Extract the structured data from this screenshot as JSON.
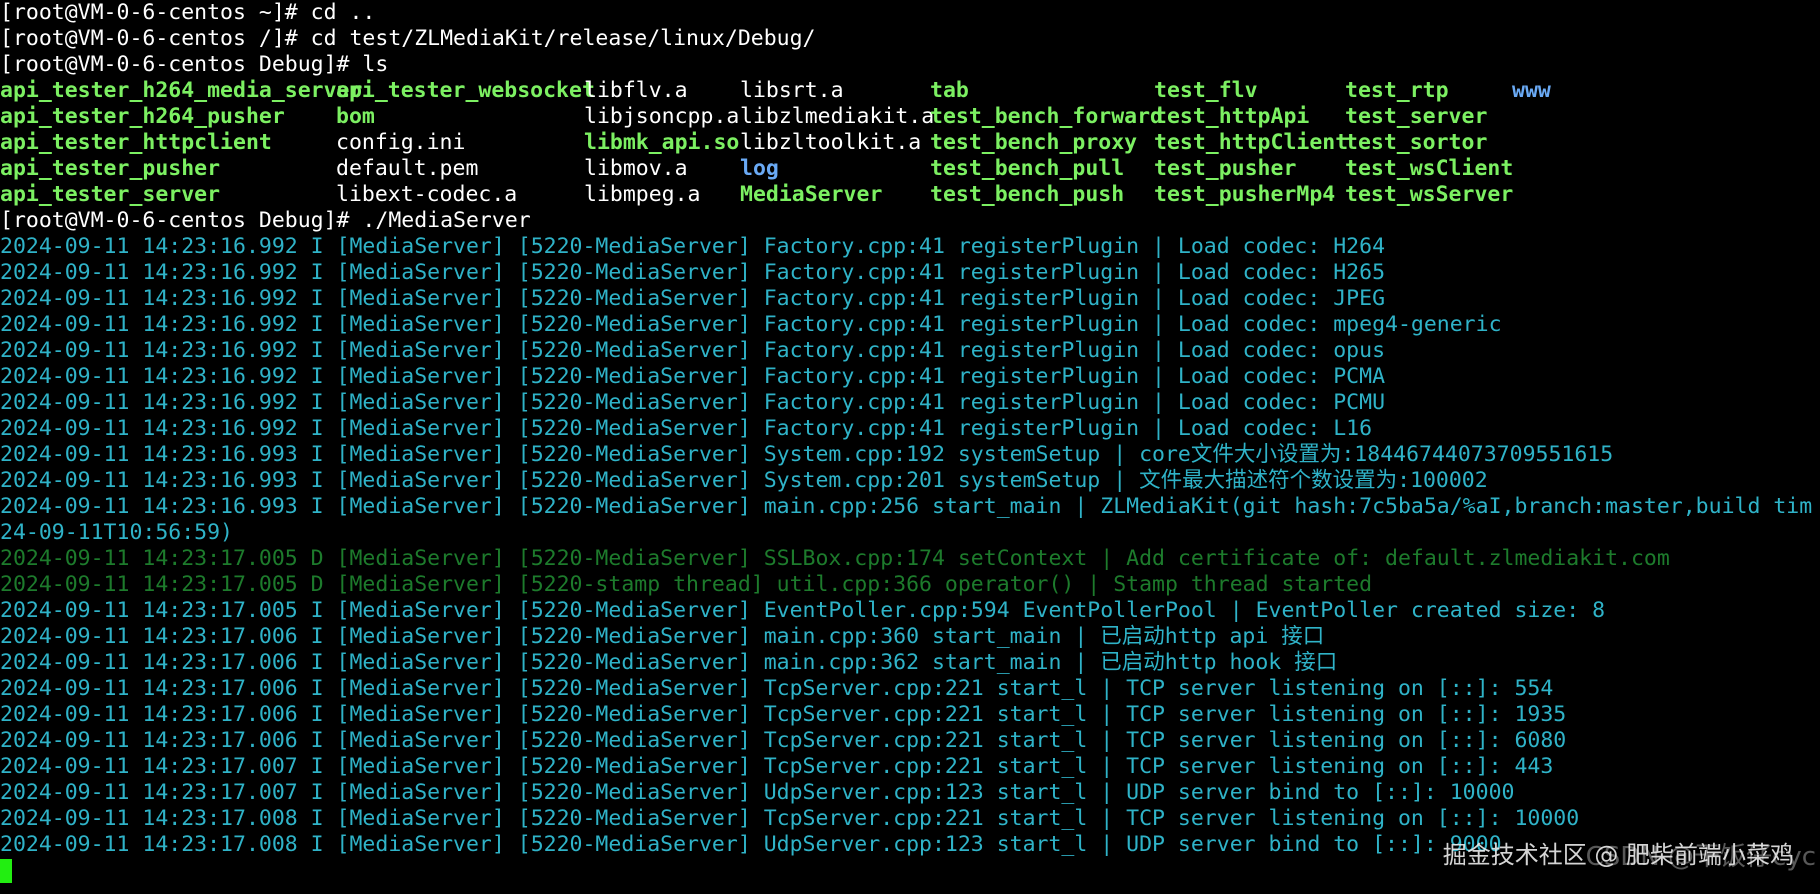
{
  "terminal": {
    "colors": {
      "background": "#000000",
      "prompt": "#ffffff",
      "executable": "#7cf062",
      "directory": "#6aaaf5",
      "info_log": "#2fb3c8",
      "debug_log": "#1d7b2c",
      "cursor": "#22ee11"
    },
    "commands": [
      "[root@VM-0-6-centos ~]# cd ..",
      "[root@VM-0-6-centos /]# cd test/ZLMediaKit/release/linux/Debug/",
      "[root@VM-0-6-centos Debug]# ls"
    ],
    "ls_listing": [
      [
        {
          "name": "api_tester_h264_media_server",
          "kind": "exe"
        },
        {
          "name": "api_tester_websocket",
          "kind": "exe"
        },
        {
          "name": "libflv.a",
          "kind": "plain"
        },
        {
          "name": "libsrt.a",
          "kind": "plain"
        },
        {
          "name": "tab",
          "kind": "exe"
        },
        {
          "name": "test_flv",
          "kind": "exe"
        },
        {
          "name": "test_rtp",
          "kind": "exe"
        },
        {
          "name": "www",
          "kind": "dir"
        }
      ],
      [
        {
          "name": "api_tester_h264_pusher",
          "kind": "exe"
        },
        {
          "name": "bom",
          "kind": "exe"
        },
        {
          "name": "libjsoncpp.a",
          "kind": "plain"
        },
        {
          "name": "libzlmediakit.a",
          "kind": "plain"
        },
        {
          "name": "test_bench_forward",
          "kind": "exe"
        },
        {
          "name": "test_httpApi",
          "kind": "exe"
        },
        {
          "name": "test_server",
          "kind": "exe"
        }
      ],
      [
        {
          "name": "api_tester_httpclient",
          "kind": "exe"
        },
        {
          "name": "config.ini",
          "kind": "plain"
        },
        {
          "name": "libmk_api.so",
          "kind": "exe"
        },
        {
          "name": "libzltoolkit.a",
          "kind": "plain"
        },
        {
          "name": "test_bench_proxy",
          "kind": "exe"
        },
        {
          "name": "test_httpClient",
          "kind": "exe"
        },
        {
          "name": "test_sortor",
          "kind": "exe"
        }
      ],
      [
        {
          "name": "api_tester_pusher",
          "kind": "exe"
        },
        {
          "name": "default.pem",
          "kind": "plain"
        },
        {
          "name": "libmov.a",
          "kind": "plain"
        },
        {
          "name": "log",
          "kind": "dir"
        },
        {
          "name": "test_bench_pull",
          "kind": "exe"
        },
        {
          "name": "test_pusher",
          "kind": "exe"
        },
        {
          "name": "test_wsClient",
          "kind": "exe"
        }
      ],
      [
        {
          "name": "api_tester_server",
          "kind": "exe"
        },
        {
          "name": "libext-codec.a",
          "kind": "plain"
        },
        {
          "name": "libmpeg.a",
          "kind": "plain"
        },
        {
          "name": "MediaServer",
          "kind": "exe"
        },
        {
          "name": "test_bench_push",
          "kind": "exe"
        },
        {
          "name": "test_pusherMp4",
          "kind": "exe"
        },
        {
          "name": "test_wsServer",
          "kind": "exe"
        }
      ]
    ],
    "run_command": "[root@VM-0-6-centos Debug]# ./MediaServer",
    "log_lines": [
      {
        "text": "2024-09-11 14:23:16.992 I [MediaServer] [5220-MediaServer] Factory.cpp:41 registerPlugin | Load codec: H264",
        "level": "info"
      },
      {
        "text": "2024-09-11 14:23:16.992 I [MediaServer] [5220-MediaServer] Factory.cpp:41 registerPlugin | Load codec: H265",
        "level": "info"
      },
      {
        "text": "2024-09-11 14:23:16.992 I [MediaServer] [5220-MediaServer] Factory.cpp:41 registerPlugin | Load codec: JPEG",
        "level": "info"
      },
      {
        "text": "2024-09-11 14:23:16.992 I [MediaServer] [5220-MediaServer] Factory.cpp:41 registerPlugin | Load codec: mpeg4-generic",
        "level": "info"
      },
      {
        "text": "2024-09-11 14:23:16.992 I [MediaServer] [5220-MediaServer] Factory.cpp:41 registerPlugin | Load codec: opus",
        "level": "info"
      },
      {
        "text": "2024-09-11 14:23:16.992 I [MediaServer] [5220-MediaServer] Factory.cpp:41 registerPlugin | Load codec: PCMA",
        "level": "info"
      },
      {
        "text": "2024-09-11 14:23:16.992 I [MediaServer] [5220-MediaServer] Factory.cpp:41 registerPlugin | Load codec: PCMU",
        "level": "info"
      },
      {
        "text": "2024-09-11 14:23:16.992 I [MediaServer] [5220-MediaServer] Factory.cpp:41 registerPlugin | Load codec: L16",
        "level": "info"
      },
      {
        "text": "2024-09-11 14:23:16.993 I [MediaServer] [5220-MediaServer] System.cpp:192 systemSetup | core文件大小设置为:18446744073709551615",
        "level": "info"
      },
      {
        "text": "2024-09-11 14:23:16.993 I [MediaServer] [5220-MediaServer] System.cpp:201 systemSetup | 文件最大描述符个数设置为:100002",
        "level": "info"
      },
      {
        "text": "2024-09-11 14:23:16.993 I [MediaServer] [5220-MediaServer] main.cpp:256 start_main | ZLMediaKit(git hash:7c5ba5a/%aI,branch:master,build tim",
        "level": "info"
      },
      {
        "text": "24-09-11T10:56:59)",
        "level": "info"
      },
      {
        "text": "2024-09-11 14:23:17.005 D [MediaServer] [5220-MediaServer] SSLBox.cpp:174 setContext | Add certificate of: default.zlmediakit.com",
        "level": "debug"
      },
      {
        "text": "2024-09-11 14:23:17.005 D [MediaServer] [5220-stamp thread] util.cpp:366 operator() | Stamp thread started",
        "level": "debug"
      },
      {
        "text": "2024-09-11 14:23:17.005 I [MediaServer] [5220-MediaServer] EventPoller.cpp:594 EventPollerPool | EventPoller created size: 8",
        "level": "info"
      },
      {
        "text": "2024-09-11 14:23:17.006 I [MediaServer] [5220-MediaServer] main.cpp:360 start_main | 已启动http api 接口",
        "level": "info"
      },
      {
        "text": "2024-09-11 14:23:17.006 I [MediaServer] [5220-MediaServer] main.cpp:362 start_main | 已启动http hook 接口",
        "level": "info"
      },
      {
        "text": "2024-09-11 14:23:17.006 I [MediaServer] [5220-MediaServer] TcpServer.cpp:221 start_l | TCP server listening on [::]: 554",
        "level": "info"
      },
      {
        "text": "2024-09-11 14:23:17.006 I [MediaServer] [5220-MediaServer] TcpServer.cpp:221 start_l | TCP server listening on [::]: 1935",
        "level": "info"
      },
      {
        "text": "2024-09-11 14:23:17.006 I [MediaServer] [5220-MediaServer] TcpServer.cpp:221 start_l | TCP server listening on [::]: 6080",
        "level": "info"
      },
      {
        "text": "2024-09-11 14:23:17.007 I [MediaServer] [5220-MediaServer] TcpServer.cpp:221 start_l | TCP server listening on [::]: 443",
        "level": "info"
      },
      {
        "text": "2024-09-11 14:23:17.007 I [MediaServer] [5220-MediaServer] UdpServer.cpp:123 start_l | UDP server bind to [::]: 10000",
        "level": "info"
      },
      {
        "text": "2024-09-11 14:23:17.008 I [MediaServer] [5220-MediaServer] TcpServer.cpp:221 start_l | TCP server listening on [::]: 10000",
        "level": "info"
      },
      {
        "text": "2024-09-11 14:23:17.008 I [MediaServer] [5220-MediaServer] UdpServer.cpp:123 start_l | UDP server bind to [::]: 9000",
        "level": "info"
      }
    ]
  },
  "watermark": {
    "text": "掘金技术社区 @ 肥柴前端小菜鸡",
    "shadow_text": "CSDN @干饭仔cyc"
  }
}
